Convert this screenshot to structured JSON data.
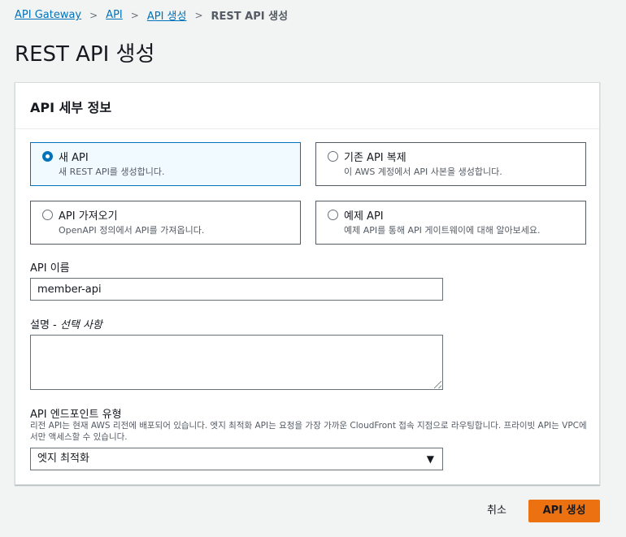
{
  "breadcrumb": {
    "items": [
      "API Gateway",
      "API",
      "API 생성"
    ],
    "current": "REST API 생성",
    "separator": ">"
  },
  "page": {
    "title": "REST API 생성"
  },
  "panel": {
    "title": "API 세부 정보",
    "options": [
      {
        "label": "새 API",
        "desc": "새 REST API를 생성합니다.",
        "selected": true
      },
      {
        "label": "기존 API 복제",
        "desc": "이 AWS 계정에서 API 사본을 생성합니다.",
        "selected": false
      },
      {
        "label": "API 가져오기",
        "desc": "OpenAPI 정의에서 API를 가져옵니다.",
        "selected": false
      },
      {
        "label": "예제 API",
        "desc": "예제 API를 통해 API 게이트웨이에 대해 알아보세요.",
        "selected": false
      }
    ],
    "name_field": {
      "label": "API 이름",
      "value": "member-api"
    },
    "desc_field": {
      "label": "설명",
      "optional": "선택 사항",
      "value": ""
    },
    "endpoint_field": {
      "label": "API 엔드포인트 유형",
      "desc": "리전 API는 현재 AWS 리전에 배포되어 있습니다. 엣지 최적화 API는 요청을 가장 가까운 CloudFront 접속 지점으로 라우팅합니다. 프라이빗 API는 VPC에서만 액세스할 수 있습니다.",
      "value": "엣지 최적화",
      "caret": "▼"
    }
  },
  "actions": {
    "cancel": "취소",
    "create": "API 생성"
  },
  "colors": {
    "accent": "#0073bb",
    "primary": "#ec7211"
  }
}
